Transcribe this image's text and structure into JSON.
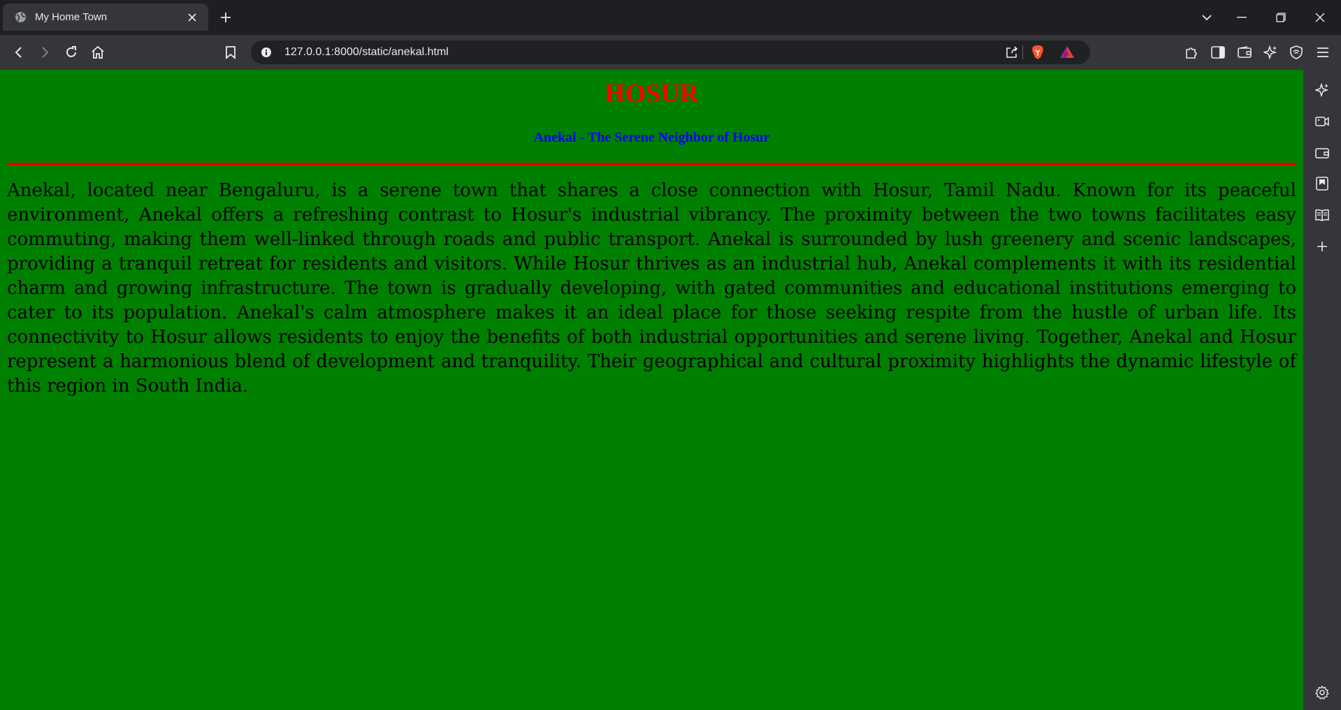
{
  "browser": {
    "tab": {
      "title": "My Home Town",
      "favicon_icon": "globe-icon"
    },
    "toolbar": {
      "url": "127.0.0.1:8000/static/anekal.html"
    },
    "colors": {
      "tabstrip": "#1f1f23",
      "toolbar": "#35363a",
      "omnibox": "#202124",
      "brave_orange": "#fb542b"
    }
  },
  "page": {
    "heading": "HOSUR",
    "subheading": "Anekal - The Serene Neighbor of Hosur",
    "paragraph": "Anekal, located near Bengaluru, is a serene town that shares a close connection with Hosur, Tamil Nadu. Known for its peaceful environment, Anekal offers a refreshing contrast to Hosur's industrial vibrancy. The proximity between the two towns facilitates easy commuting, making them well-linked through roads and public transport. Anekal is surrounded by lush greenery and scenic landscapes, providing a tranquil retreat for residents and visitors. While Hosur thrives as an industrial hub, Anekal complements it with its residential charm and growing infrastructure. The town is gradually developing, with gated communities and educational institutions emerging to cater to its population. Anekal's calm atmosphere makes it an ideal place for those seeking respite from the hustle of urban life. Its connectivity to Hosur allows residents to enjoy the benefits of both industrial opportunities and serene living. Together, Anekal and Hosur represent a harmonious blend of development and tranquility. Their geographical and cultural proximity highlights the dynamic lifestyle of this region in South India.",
    "colors": {
      "background": "#008000",
      "heading": "#ff0000",
      "subheading": "#0000ff",
      "rule": "#e00000",
      "text": "#000000"
    }
  }
}
